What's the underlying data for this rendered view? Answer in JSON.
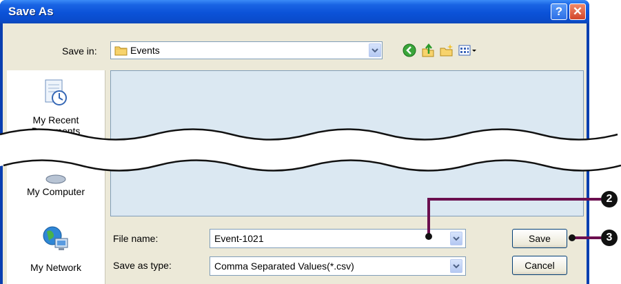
{
  "window": {
    "title": "Save As",
    "help_glyph": "?",
    "close_glyph": "✕"
  },
  "toolbar": {
    "save_in_label": "Save in:",
    "save_in_value": "Events",
    "icons": [
      "back-icon",
      "up-folder-icon",
      "new-folder-icon",
      "views-menu-icon"
    ]
  },
  "places": [
    {
      "label_line1": "My Recent",
      "label_line2": "Documents",
      "icon": "recent-documents-icon"
    },
    {
      "label_line1": "My Computer",
      "label_line2": "",
      "icon": "my-computer-icon"
    },
    {
      "label_line1": "My Network",
      "label_line2": "",
      "icon": "my-network-icon"
    }
  ],
  "form": {
    "file_name_label": "File name:",
    "file_name_value": "Event-1021",
    "save_type_label": "Save as type:",
    "save_type_value": "Comma Separated Values(*.csv)"
  },
  "buttons": {
    "save": "Save",
    "cancel": "Cancel"
  },
  "callouts": {
    "filename_step": "2",
    "save_step": "3"
  },
  "colors": {
    "callout_line": "#6b0f4f",
    "title_bar": "#0b52d8",
    "file_list_bg": "#dbe8f2"
  }
}
